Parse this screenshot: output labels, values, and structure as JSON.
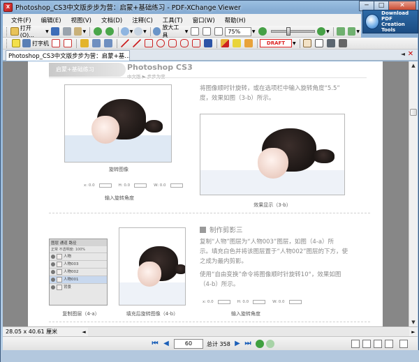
{
  "window": {
    "title": "Photoshop_CS3中文版步步为营：启蒙+基础练习 - PDF-XChange Viewer",
    "app_icon_letter": "X",
    "controls": {
      "minimize": "─",
      "maximize": "□",
      "close": "✕"
    }
  },
  "download_badge": {
    "line1": "Download PDF",
    "line2": "Creation Tools"
  },
  "menu": [
    "文件(F)",
    "编辑(E)",
    "视图(V)",
    "文档(D)",
    "注释(C)",
    "工具(T)",
    "窗口(W)",
    "帮助(H)"
  ],
  "toolbar1": {
    "open_label": "打开(O)...",
    "zoom_tool_label": "放大工具",
    "zoom_value": "75%"
  },
  "toolbar2": {
    "typewriter_label": "打字机",
    "draft_stamp": "DRAFT"
  },
  "tab": {
    "label": "Photoshop_CS3中文版步步为营：启蒙+基...",
    "close": "✕",
    "prev": "◄"
  },
  "page": {
    "header_band": "启蒙+基础练习",
    "brand": "Photoshop CS3",
    "brand_sub": "中文版 ▶ 步步为营",
    "para1_line1": "将图像顺时针旋转，或在选项栏中输入旋转角度“5.5”",
    "para1_line2": "度，效果如图（3-b）所示。",
    "cap_rotate_image": "旋转图像",
    "cap_input_angle": "输入旋转角度",
    "cap_result_3b": "效果显示（3-b）",
    "section_title": "制作剪影三",
    "para2_line1": "复制“人物”图层为“人物003”图层，如图（4-a）所",
    "para2_line2": "示。填充白色并将该图层置于“人物002”图层的下方，使",
    "para2_line3": "之成为最内剪影。",
    "para3_line1": "使用“自由变换”命令将图像顺时针旋转10°，效果如图",
    "para3_line2": "（4-b）所示。",
    "cap_copy_layer": "复制图层（4-a）",
    "cap_fill_rotate": "填充后旋转图像（4-b）",
    "cap_input_angle2": "输入旋转角度",
    "params1": [
      "x: 0.0",
      "H: 0.0",
      "W: 0.0"
    ],
    "params2": [
      "x: 0.0",
      "H: 0.0",
      "W: 0.0"
    ],
    "layers_panel": {
      "tabs": "图层  通道  路径",
      "blend_row": "正常   不透明度: 100%",
      "rows": [
        "人物",
        "人物003",
        "人物002",
        "人物001",
        "背景"
      ]
    }
  },
  "status": {
    "dimensions": "28.05 x 40.61 厘米"
  },
  "nav": {
    "first": "⏮",
    "prev": "◀",
    "page_input": "60",
    "total": "总计 358",
    "next": "▶",
    "last": "⏭"
  }
}
